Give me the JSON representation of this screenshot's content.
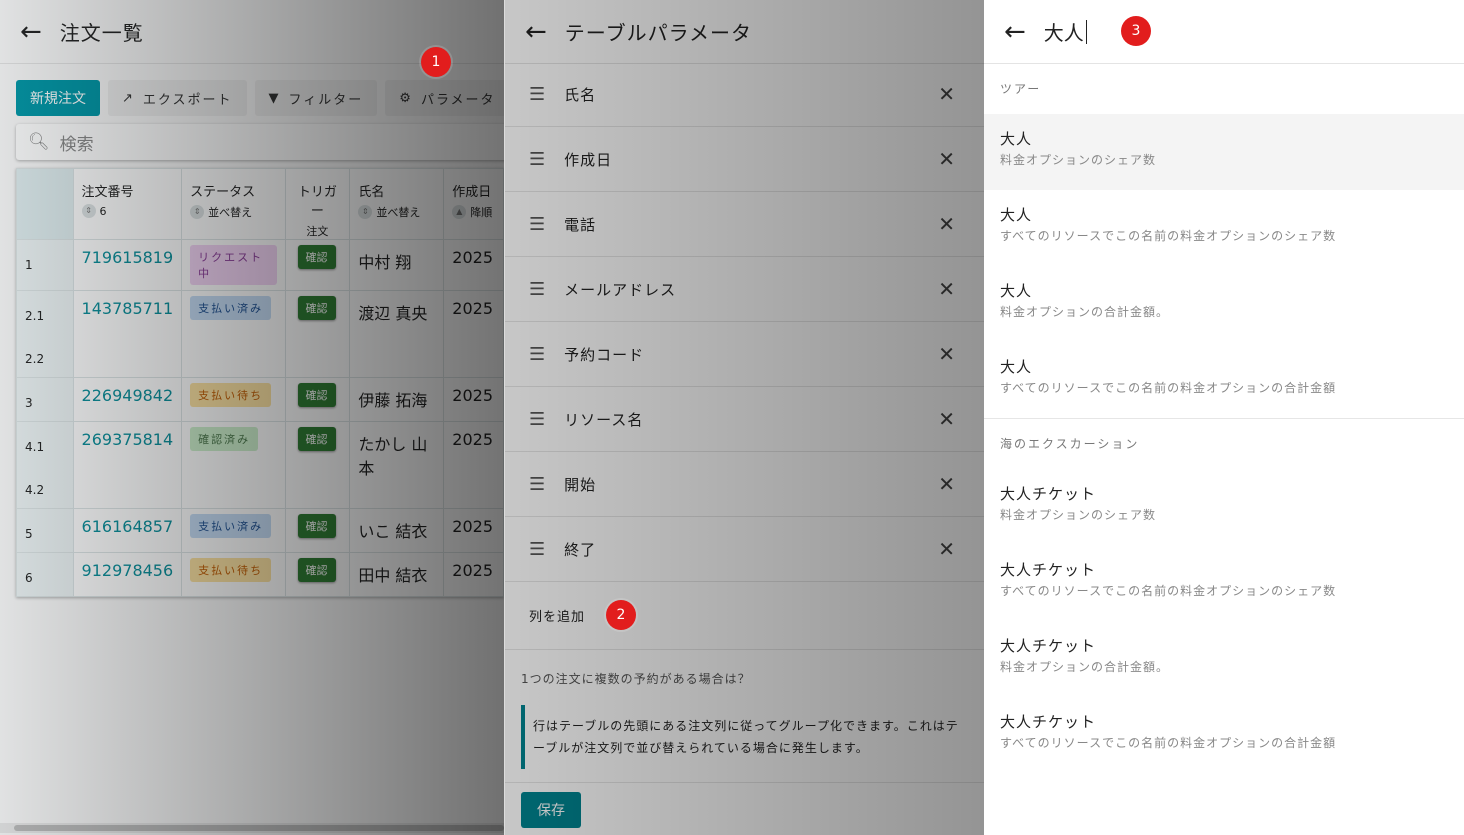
{
  "left": {
    "back_icon": "arrow-left",
    "title": "注文一覧",
    "toolbar": {
      "new": "新規注文",
      "export": "エクスポート",
      "filter": "フィルター",
      "params": "パラメータ"
    },
    "search_placeholder": "検索",
    "columns": [
      {
        "label": "注文番号",
        "sub": "6"
      },
      {
        "label": "ステータス",
        "sub": "並べ替え"
      },
      {
        "label": "トリガー",
        "sub": "注文"
      },
      {
        "label": "氏名",
        "sub": "並べ替え"
      },
      {
        "label": "作成日",
        "sub": "降順"
      }
    ],
    "rows": [
      {
        "num": [
          "1"
        ],
        "order": "719615819",
        "status": "リクエスト中",
        "cls": "b-req",
        "trigger": "確認",
        "name": "中村 翔",
        "created": "2025"
      },
      {
        "num": [
          "2.1",
          "2.2"
        ],
        "order": "143785711",
        "status": "支払い済み",
        "cls": "b-paid",
        "trigger": "確認",
        "name": "渡辺 真央",
        "created": "2025"
      },
      {
        "num": [
          "3"
        ],
        "order": "226949842",
        "status": "支払い待ち",
        "cls": "b-wait",
        "trigger": "確認",
        "name": "伊藤 拓海",
        "created": "2025"
      },
      {
        "num": [
          "4.1",
          "4.2"
        ],
        "order": "269375814",
        "status": "確認済み",
        "cls": "b-conf",
        "trigger": "確認",
        "name": "たかし 山本",
        "created": "2025"
      },
      {
        "num": [
          "5"
        ],
        "order": "616164857",
        "status": "支払い済み",
        "cls": "b-paid",
        "trigger": "確認",
        "name": "いこ 結衣",
        "created": "2025"
      },
      {
        "num": [
          "6"
        ],
        "order": "912978456",
        "status": "支払い待ち",
        "cls": "b-wait",
        "trigger": "確認",
        "name": "田中 結衣",
        "created": "2025"
      }
    ]
  },
  "mid": {
    "title": "テーブルパラメータ",
    "columns": [
      "氏名",
      "作成日",
      "電話",
      "メールアドレス",
      "予約コード",
      "リソース名",
      "開始",
      "終了"
    ],
    "add_column": "列を追加",
    "question": "1つの注文に複数の予約がある場合は？",
    "note": "行はテーブルの先頭にある注文列に従ってグループ化できます。これはテーブルが注文列で並び替えられている場合に発生します。",
    "save": "保存"
  },
  "right": {
    "query": "大人",
    "groups": [
      {
        "name": "ツアー",
        "options": [
          {
            "main": "大人",
            "sub": "料金オプションのシェア数"
          },
          {
            "main": "大人",
            "sub": "すべてのリソースでこの名前の料金オプションのシェア数"
          },
          {
            "main": "大人",
            "sub": "料金オプションの合計金額。"
          },
          {
            "main": "大人",
            "sub": "すべてのリソースでこの名前の料金オプションの合計金額"
          }
        ]
      },
      {
        "name": "海のエクスカーション",
        "options": [
          {
            "main": "大人チケット",
            "sub": "料金オプションのシェア数"
          },
          {
            "main": "大人チケット",
            "sub": "すべてのリソースでこの名前の料金オプションのシェア数"
          },
          {
            "main": "大人チケット",
            "sub": "料金オプションの合計金額。"
          },
          {
            "main": "大人チケット",
            "sub": "すべてのリソースでこの名前の料金オプションの合計金額"
          }
        ]
      }
    ]
  },
  "markers": [
    "1",
    "2",
    "3"
  ],
  "colors": {
    "accent": "#0097a7",
    "marker": "#e21d1d",
    "confirm": "#2e7d32"
  }
}
